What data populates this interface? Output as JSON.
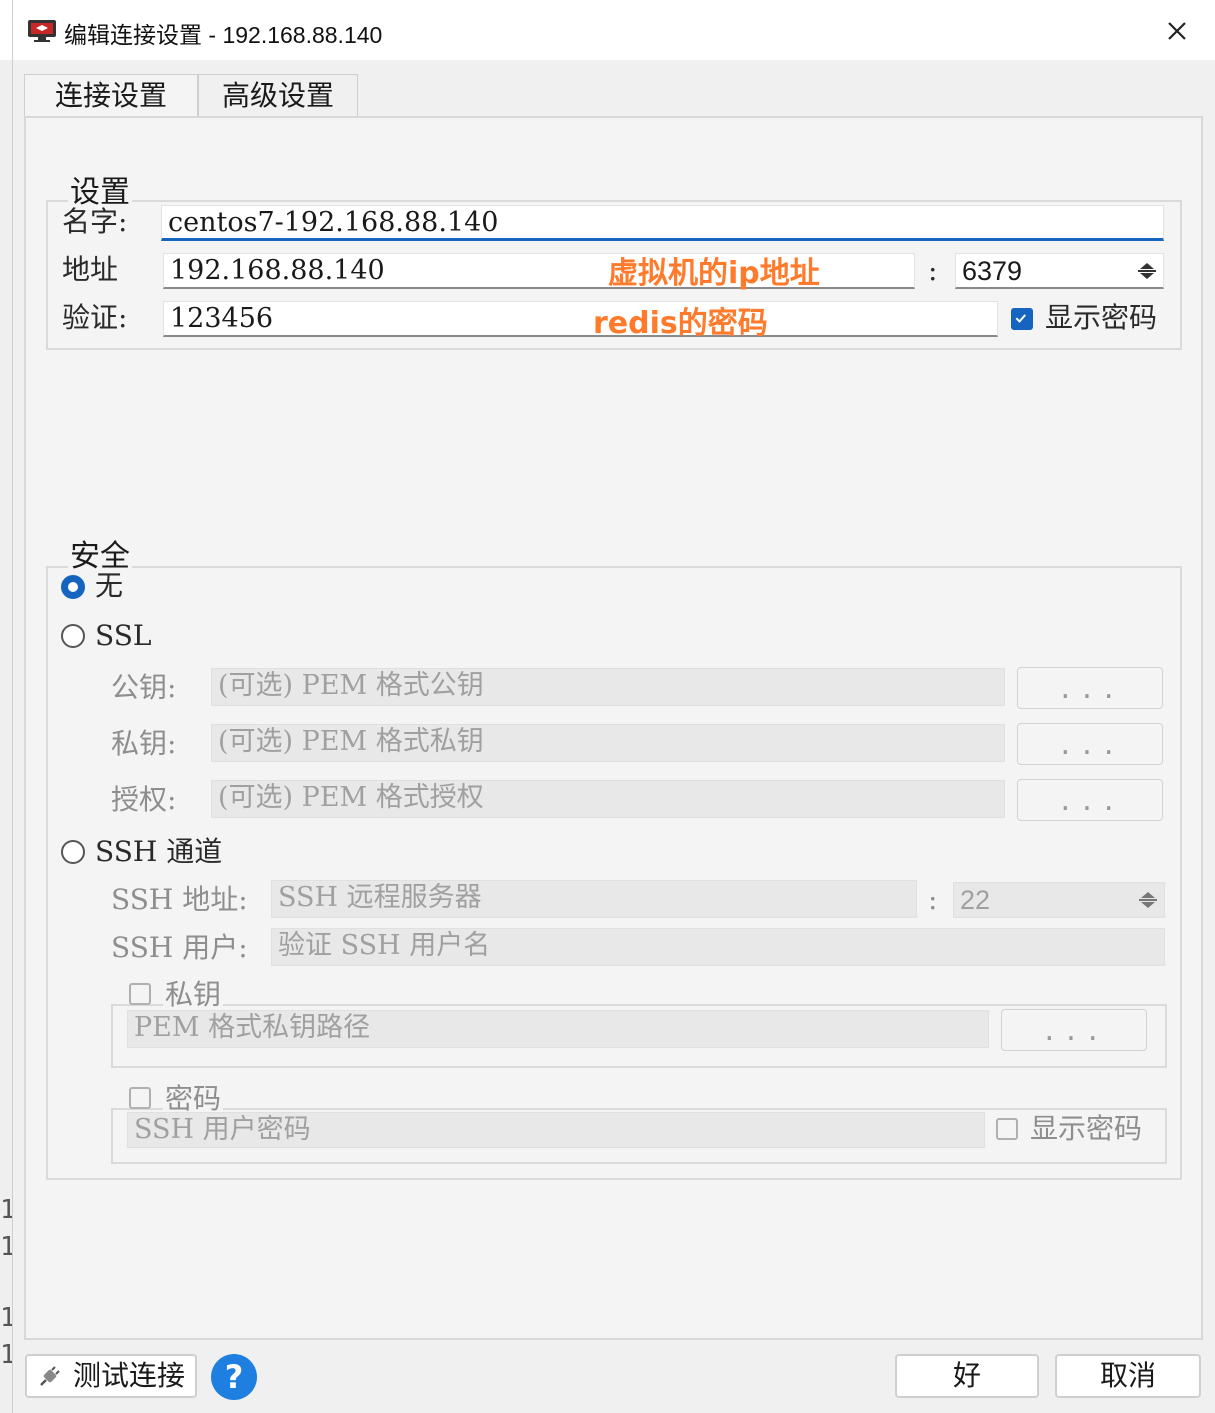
{
  "window": {
    "title": "编辑连接设置 - 192.168.88.140"
  },
  "tabs": [
    {
      "label": "连接设置",
      "active": true
    },
    {
      "label": "高级设置",
      "active": false
    }
  ],
  "settings": {
    "group_label": "设置",
    "name_label": "名字:",
    "name_value": "centos7-192.168.88.140",
    "address_label": "地址",
    "address_value": "192.168.88.140",
    "port_separator": ":",
    "port_value": "6379",
    "auth_label": "验证:",
    "auth_value": "123456",
    "show_password_label": "显示密码",
    "show_password_checked": true
  },
  "annotations": {
    "address_note": "虚拟机的ip地址",
    "auth_note": "redis的密码",
    "color": "#ff7a2a"
  },
  "security": {
    "group_label": "安全",
    "none_label": "无",
    "ssl_label": "SSL",
    "public_key_label": "公钥:",
    "public_key_placeholder": "(可选) PEM 格式公钥",
    "private_key_label": "私钥:",
    "private_key_placeholder": "(可选) PEM 格式私钥",
    "authority_label": "授权:",
    "authority_placeholder": "(可选) PEM 格式授权",
    "browse_label": "...",
    "ssh_label": "SSH 通道",
    "ssh_address_label": "SSH 地址:",
    "ssh_address_placeholder": "SSH 远程服务器",
    "ssh_port_separator": ":",
    "ssh_port_value": "22",
    "ssh_user_label": "SSH 用户:",
    "ssh_user_placeholder": "验证 SSH 用户名",
    "private_key_box_label": "私钥",
    "private_key_path_placeholder": "PEM 格式私钥路径",
    "password_box_label": "密码",
    "ssh_password_placeholder": "SSH 用户密码",
    "ssh_show_password_label": "显示密码"
  },
  "footer": {
    "test_label": "测试连接",
    "help_label": "?",
    "ok_label": "好",
    "cancel_label": "取消"
  },
  "colors": {
    "accent": "#1565c0",
    "help": "#1e7fe0"
  }
}
